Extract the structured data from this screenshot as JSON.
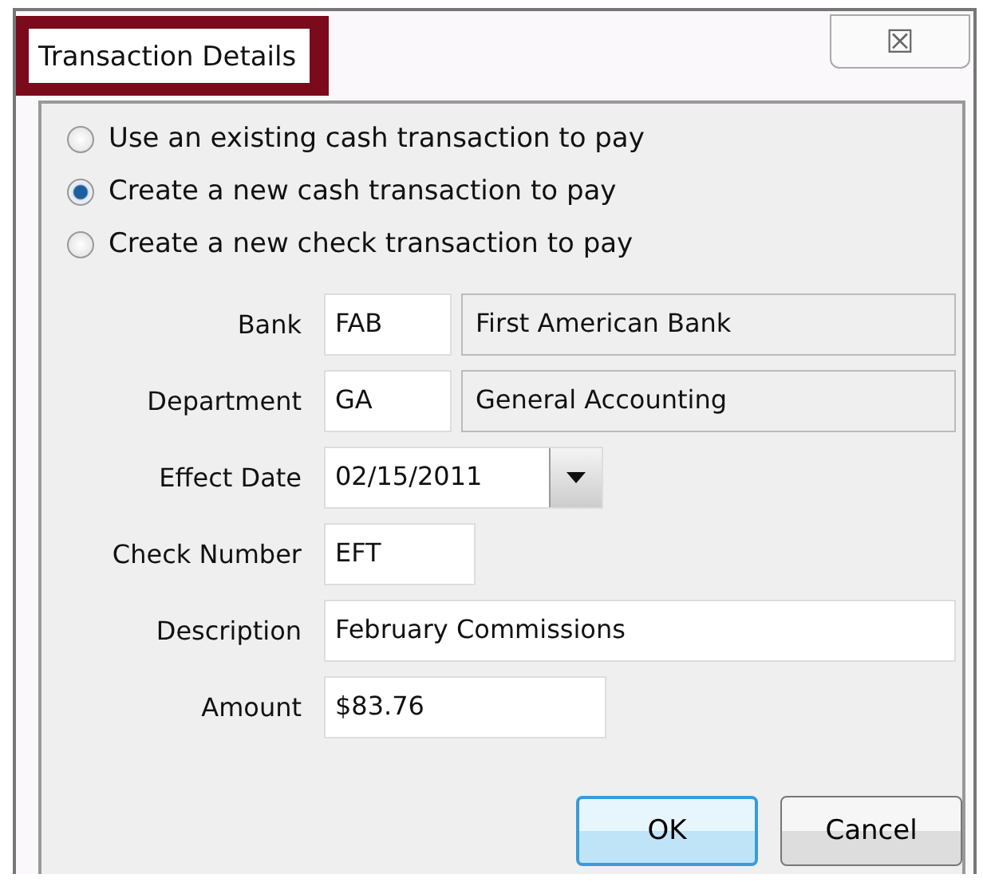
{
  "window": {
    "title": "Transaction Details",
    "close_icon": "☒"
  },
  "options": [
    {
      "label": "Use an existing cash transaction to pay",
      "selected": false
    },
    {
      "label": "Create a new cash transaction to pay",
      "selected": true
    },
    {
      "label": "Create a new check transaction to pay",
      "selected": false
    }
  ],
  "fields": [
    {
      "kind": "lookup",
      "label": "Bank",
      "value": "FAB",
      "name": "First American Bank"
    },
    {
      "kind": "lookup",
      "label": "Department",
      "value": "GA",
      "name": "General Accounting"
    },
    {
      "kind": "date",
      "label": "Effect Date",
      "value": "02/15/2011"
    },
    {
      "kind": "short",
      "label": "Check Number",
      "value": "EFT"
    },
    {
      "kind": "wide",
      "label": "Description",
      "value": "February Commissions"
    },
    {
      "kind": "medium",
      "label": "Amount",
      "value": "$83.76"
    }
  ],
  "buttons": [
    {
      "label": "OK",
      "default": true
    },
    {
      "label": "Cancel",
      "default": false
    }
  ]
}
